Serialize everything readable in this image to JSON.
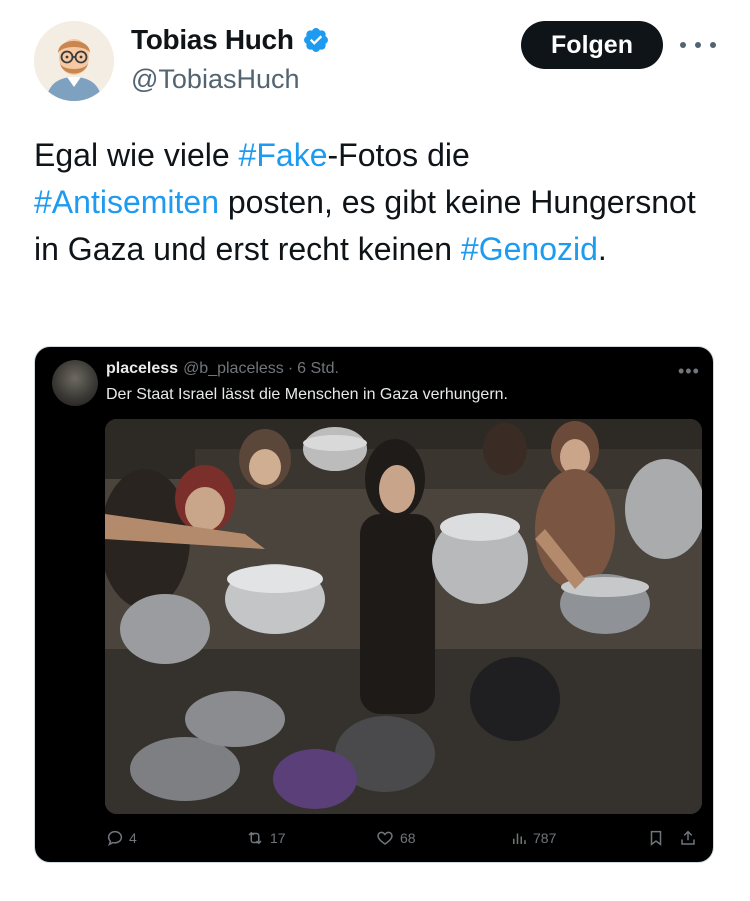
{
  "author": {
    "display_name": "Tobias Huch",
    "handle": "@TobiasHuch",
    "verified": true,
    "follow_label": "Folgen"
  },
  "tweet": {
    "parts": [
      {
        "text": "Egal wie viele ",
        "hashtag": false
      },
      {
        "text": "#Fake",
        "hashtag": true
      },
      {
        "text": "-Fotos die",
        "hashtag": false
      },
      {
        "text": "#Antisemiten",
        "hashtag": true
      },
      {
        "text": " posten, es gibt keine Hungersnot in Gaza und erst recht keinen ",
        "hashtag": false
      },
      {
        "text": "#Genozid",
        "hashtag": true
      },
      {
        "text": ".",
        "hashtag": false
      }
    ]
  },
  "quoted": {
    "name": "placeless",
    "handle": "@b_placeless",
    "separator": "·",
    "time": "6 Std.",
    "text": "Der Staat Israel lässt die Menschen in Gaza verhungern.",
    "stats": {
      "replies": "4",
      "reposts": "17",
      "likes": "68",
      "views": "787"
    }
  },
  "colors": {
    "link": "#1d9bf0",
    "verified": "#1d9bf0",
    "button_bg": "#0f1419",
    "embed_bg": "#000000"
  },
  "icons": [
    "verified-badge-icon",
    "more-icon",
    "reply-icon",
    "repost-icon",
    "like-icon",
    "views-icon",
    "bookmark-icon",
    "share-icon"
  ]
}
